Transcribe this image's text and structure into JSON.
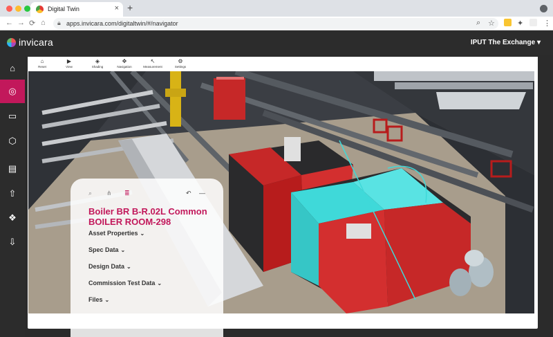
{
  "browser": {
    "tab_title": "Digital Twin",
    "tab_close": "×",
    "new_tab": "+",
    "url": "apps.invicara.com/digitaltwin/#/navigator",
    "nav_back": "←",
    "nav_forward": "→",
    "nav_reload": "⟳",
    "nav_home": "⌂"
  },
  "app": {
    "brand": "invicara",
    "project_name": "IPUT The Exchange ▾"
  },
  "sidebar": {
    "items": [
      {
        "icon": "home-icon",
        "glyph": "⌂"
      },
      {
        "icon": "navigator-icon",
        "glyph": "◎"
      },
      {
        "icon": "box-icon",
        "glyph": "▭"
      },
      {
        "icon": "cube-icon",
        "glyph": "⬡"
      },
      {
        "icon": "document-icon",
        "glyph": "▤"
      },
      {
        "icon": "upload-icon",
        "glyph": "⇧"
      },
      {
        "icon": "cluster-icon",
        "glyph": "❖"
      },
      {
        "icon": "download-icon",
        "glyph": "⇩"
      }
    ]
  },
  "viewer_toolbar": {
    "items": [
      {
        "label": "Reset",
        "glyph": "⌂"
      },
      {
        "label": "View",
        "glyph": "▶"
      },
      {
        "label": "Shading",
        "glyph": "◈"
      },
      {
        "label": "Navigation",
        "glyph": "✥"
      },
      {
        "label": "Measurement",
        "glyph": "↖"
      },
      {
        "label": "Settings",
        "glyph": "⚙"
      }
    ]
  },
  "panel": {
    "title_line1": "Boiler BR B-R.02L Common",
    "title_line2": "BOILER ROOM-298",
    "sections": [
      "Asset Properties",
      "Spec Data",
      "Design Data",
      "Commission Test Data",
      "Files"
    ],
    "chevron": "⌄"
  },
  "colors": {
    "accent": "#c2185b",
    "boiler_red": "#d32f2f",
    "highlight_cyan": "#3fd9d9"
  }
}
